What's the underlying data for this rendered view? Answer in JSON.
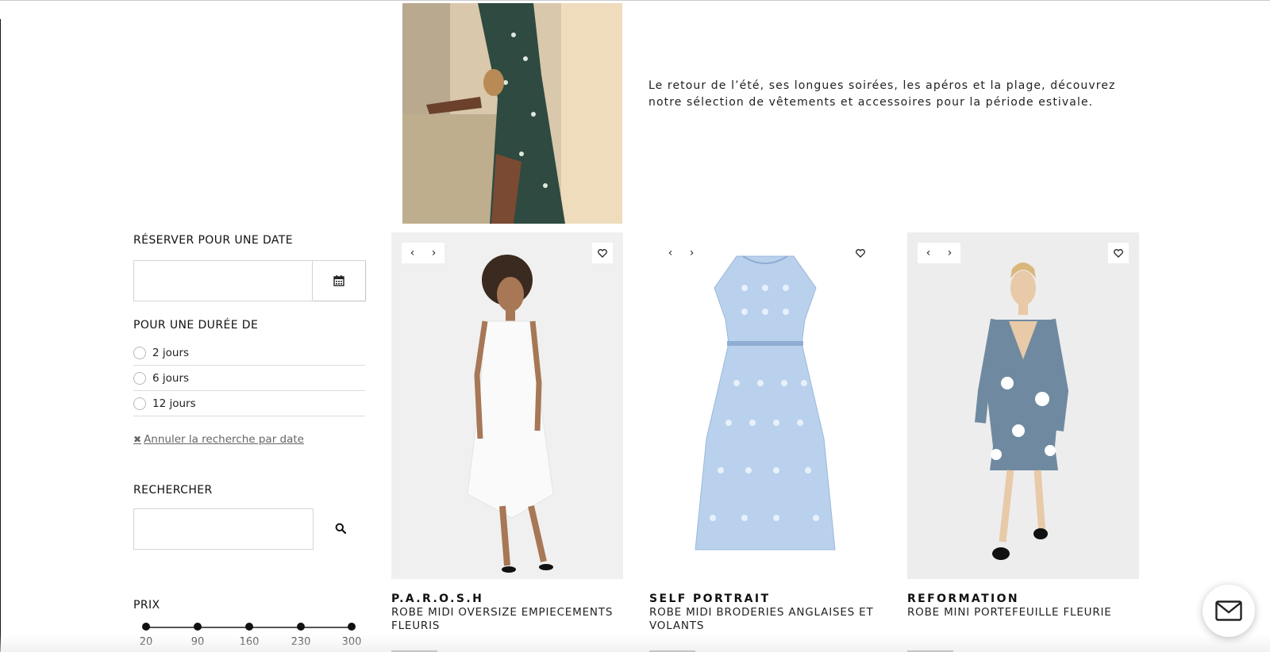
{
  "intro": {
    "text": "Le retour de l’été, ses longues soirées, les apéros et la plage, découvrez notre sélection de vêtements et accessoires pour la période estivale."
  },
  "sidebar": {
    "date_title": "RÉSERVER POUR UNE DATE",
    "date_value": "",
    "calendar_icon": "calendar-icon",
    "duration_title": "POUR UNE DURÉE DE",
    "durations": [
      {
        "label": "2 jours",
        "checked": false
      },
      {
        "label": "6 jours",
        "checked": false
      },
      {
        "label": "12 jours",
        "checked": false
      }
    ],
    "cancel_label": " Annuler la recherche par date",
    "search_title": "RECHERCHER",
    "search_value": "",
    "price_title": "PRIX",
    "price_ticks": [
      "20",
      "90",
      "160",
      "230",
      "300"
    ]
  },
  "products": [
    {
      "brand": "P.A.R.O.S.H",
      "name": "ROBE MIDI OVERSIZE EMPIECEMENTS FLEURIS"
    },
    {
      "brand": "SELF PORTRAIT",
      "name": "ROBE MIDI BRODERIES ANGLAISES ET VOLANTS"
    },
    {
      "brand": "REFORMATION",
      "name": "ROBE MINI PORTEFEUILLE FLEURIE"
    }
  ],
  "card_controls": {
    "prev": "‹",
    "next": "›"
  },
  "icons": {
    "heart": "heart-icon",
    "search": "search-icon",
    "mail": "mail-icon",
    "close": "close-icon"
  },
  "colors": {
    "text": "#111111",
    "border": "#d4d4d4",
    "card_bg": "#f1f1f1"
  }
}
